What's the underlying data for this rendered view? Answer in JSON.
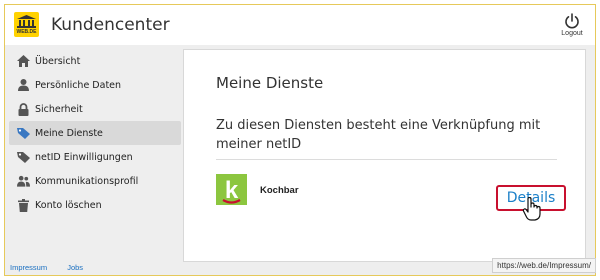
{
  "header": {
    "logo_text": "WEB.DE",
    "title": "Kundencenter",
    "logout_label": "Logout"
  },
  "sidebar": {
    "items": [
      {
        "label": "Übersicht",
        "icon": "home-icon",
        "active": false
      },
      {
        "label": "Persönliche Daten",
        "icon": "person-icon",
        "active": false
      },
      {
        "label": "Sicherheit",
        "icon": "lock-icon",
        "active": false
      },
      {
        "label": "Meine Dienste",
        "icon": "tag-icon",
        "active": true
      },
      {
        "label": "netID Einwilligungen",
        "icon": "tag-icon",
        "active": false
      },
      {
        "label": "Kommunikationsprofil",
        "icon": "people-icon",
        "active": false
      },
      {
        "label": "Konto löschen",
        "icon": "trash-icon",
        "active": false
      }
    ]
  },
  "main": {
    "title": "Meine Dienste",
    "description": "Zu diesen Diensten besteht eine Verknüpfung mit meiner netID",
    "services": [
      {
        "name": "Kochbar",
        "logo_letter": "k",
        "logo_color": "#8cc63f",
        "details_label": "Details"
      }
    ]
  },
  "footer": {
    "links": [
      "Impressum",
      "Jobs"
    ],
    "status_url": "https://web.de/Impressum/"
  },
  "colors": {
    "brand": "#ffd200",
    "accent_link": "#1a7fc8",
    "highlight_border": "#c8102e"
  }
}
